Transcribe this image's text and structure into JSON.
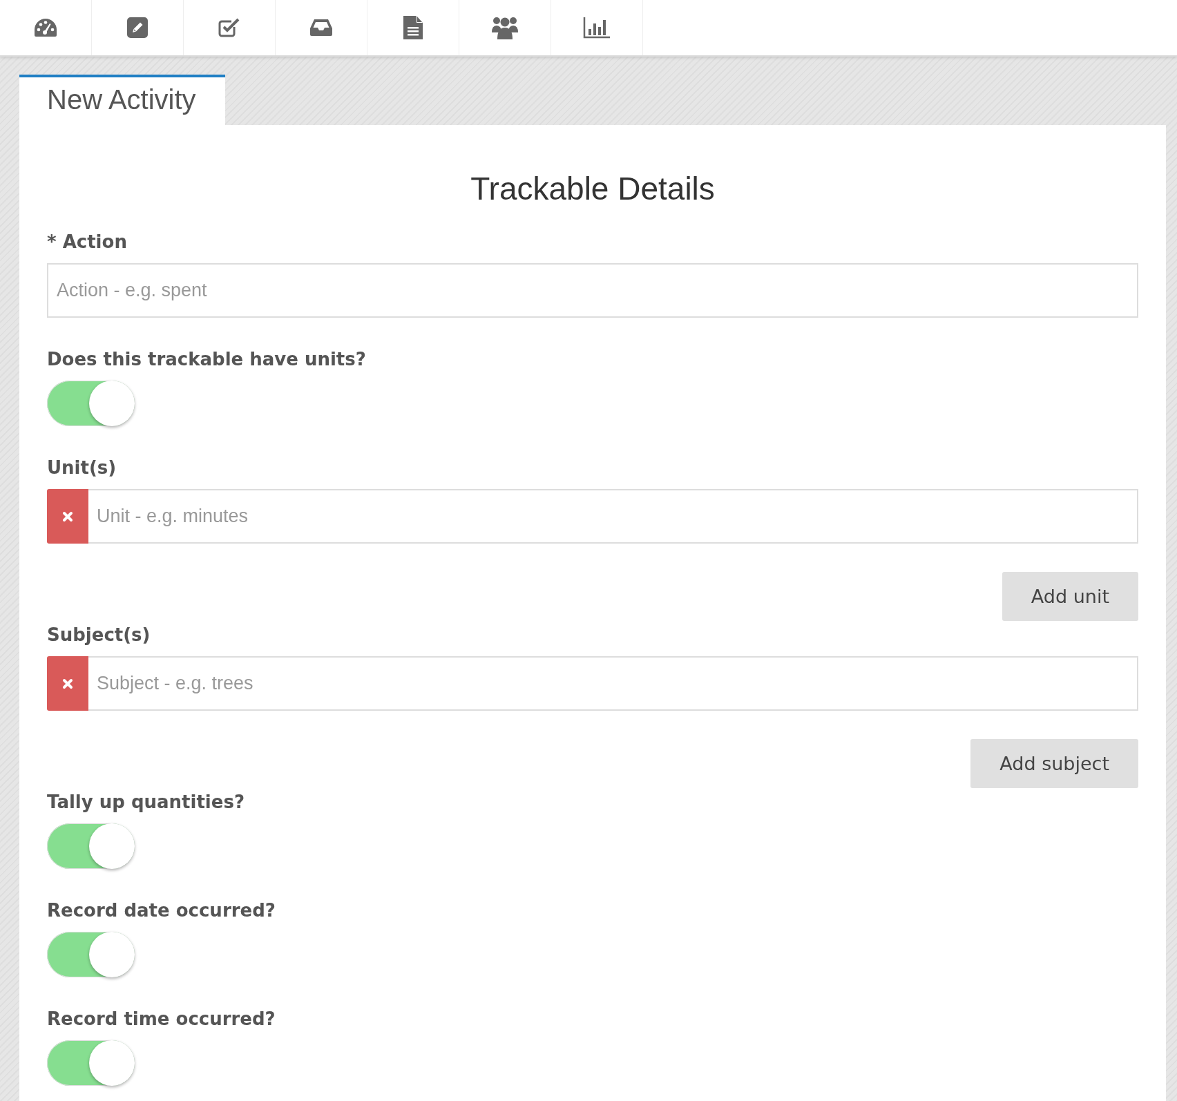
{
  "tab": {
    "label": "New Activity"
  },
  "title": "Trackable Details",
  "fields": [
    {
      "kind": "text",
      "label": "* Action",
      "placeholder": "Action - e.g. spent"
    },
    {
      "kind": "toggle",
      "label": "Does this trackable have units?",
      "on": true
    },
    {
      "kind": "list",
      "label": "Unit(s)",
      "placeholder": "Unit - e.g. minutes",
      "button": "Add unit"
    },
    {
      "kind": "list",
      "label": "Subject(s)",
      "placeholder": "Subject - e.g. trees",
      "button": "Add subject"
    },
    {
      "kind": "toggle",
      "label": "Tally up quantities?",
      "on": true
    },
    {
      "kind": "toggle",
      "label": "Record date occurred?",
      "on": true
    },
    {
      "kind": "toggle",
      "label": "Record time occurred?",
      "on": true
    }
  ]
}
